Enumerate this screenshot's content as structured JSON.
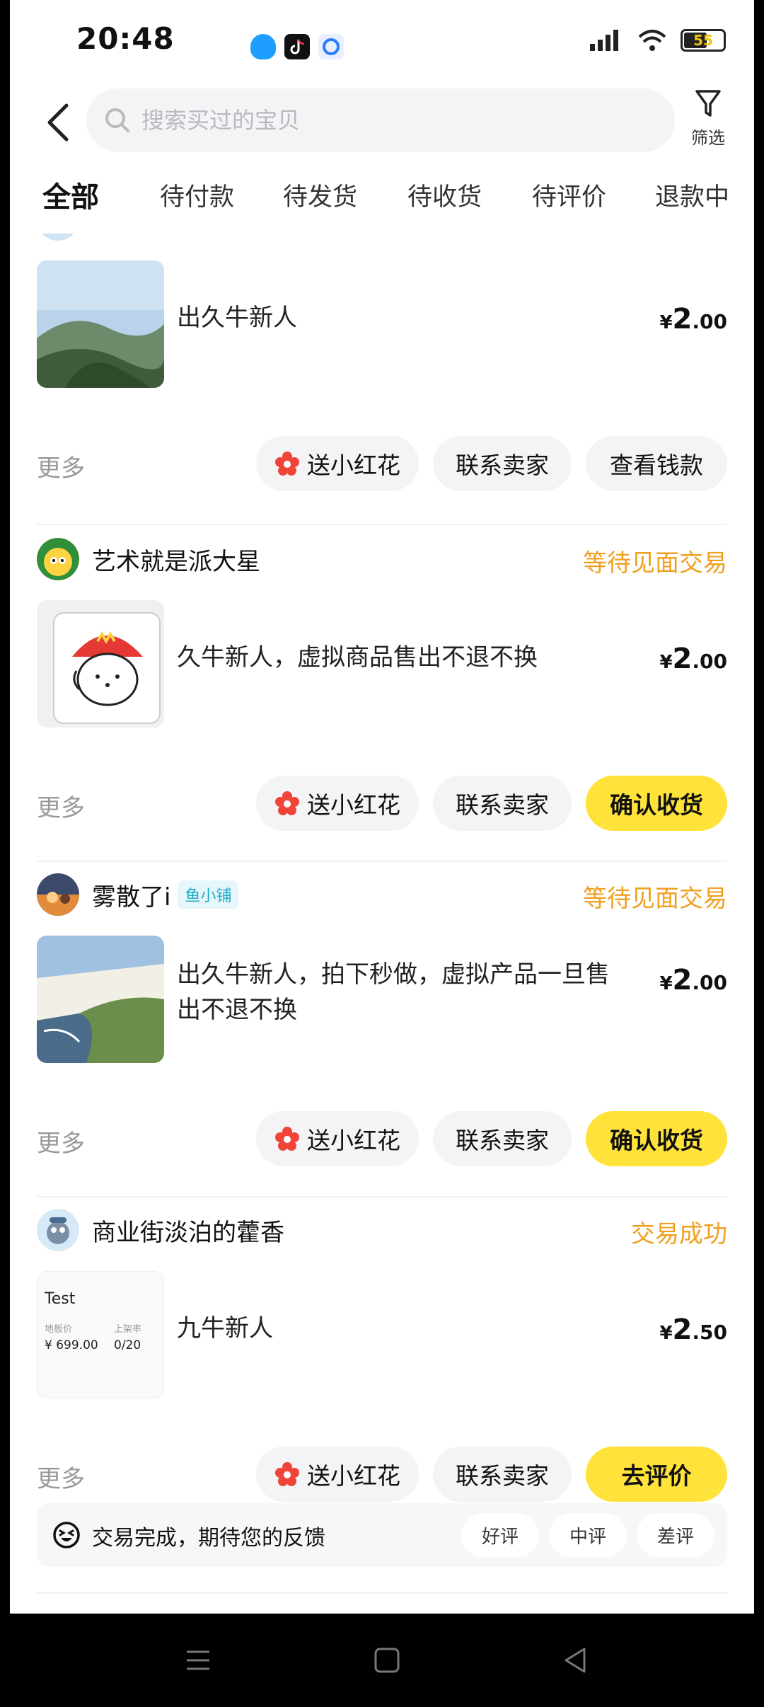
{
  "status_bar": {
    "time": "20:48",
    "battery": "55"
  },
  "header": {
    "search_placeholder": "搜索买过的宝贝",
    "filter_label": "筛选"
  },
  "tabs": [
    {
      "label": "全部"
    },
    {
      "label": "待付款"
    },
    {
      "label": "待发货"
    },
    {
      "label": "待收货"
    },
    {
      "label": "待评价"
    },
    {
      "label": "退款中"
    }
  ],
  "orders": [
    {
      "seller": "",
      "status": "",
      "title": "出久牛新人",
      "price": {
        "currency": "¥",
        "int": "2",
        "dec": ".00"
      },
      "more": "更多",
      "actions": [
        "送小红花",
        "联系卖家",
        "查看钱款"
      ]
    },
    {
      "seller": "艺术就是派大星",
      "status": "等待见面交易",
      "title": "久牛新人，虚拟商品售出不退不换",
      "price": {
        "currency": "¥",
        "int": "2",
        "dec": ".00"
      },
      "more": "更多",
      "actions": [
        "送小红花",
        "联系卖家",
        "确认收货"
      ]
    },
    {
      "seller": "雾散了i",
      "badge": "鱼小铺",
      "status": "等待见面交易",
      "title": "出久牛新人，拍下秒做，虚拟产品一旦售出不退不换",
      "price": {
        "currency": "¥",
        "int": "2",
        "dec": ".00"
      },
      "more": "更多",
      "actions": [
        "送小红花",
        "联系卖家",
        "确认收货"
      ]
    },
    {
      "seller": "商业街淡泊的藿香",
      "status": "交易成功",
      "title": "九牛新人",
      "thumb_text": {
        "title": "Test",
        "label1": "地板价",
        "label2": "上架率",
        "value1": "¥ 699.00",
        "value2": "0/20"
      },
      "price": {
        "currency": "¥",
        "int": "2",
        "dec": ".50"
      },
      "more": "更多",
      "actions": [
        "送小红花",
        "联系卖家",
        "去评价"
      ]
    }
  ],
  "feedback": {
    "text": "交易完成，期待您的反馈",
    "options": [
      "好评",
      "中评",
      "差评"
    ]
  },
  "colors": {
    "accent_yellow": "#ffe23a",
    "status_orange": "#f0a020",
    "badge_teal": "#1aa9c9"
  }
}
